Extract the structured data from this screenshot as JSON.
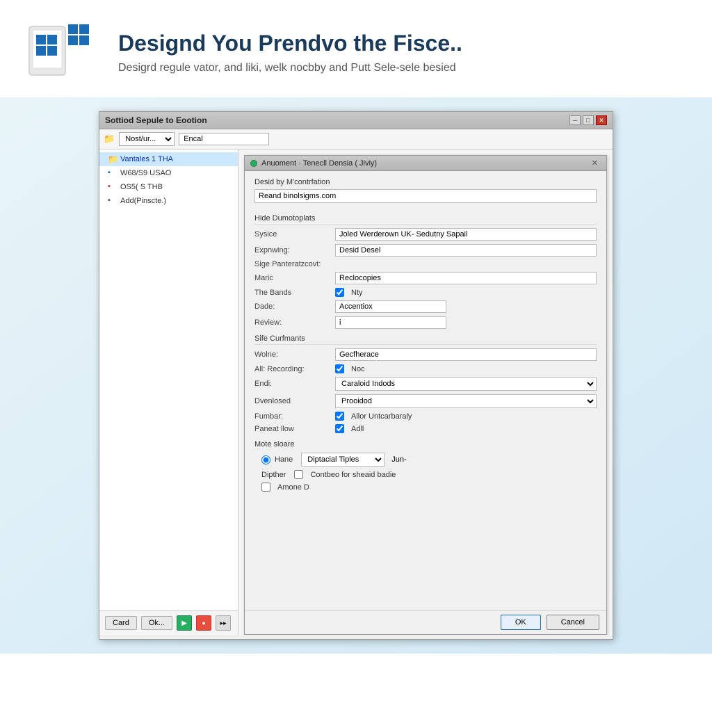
{
  "header": {
    "title": "Designd You Prendvo the Fisce..",
    "subtitle": "Desigrd regule vator, and liki, welk nocbby and Putt Sele-sele besied",
    "logo_alt": "Windows logo with tablet"
  },
  "outer_dialog": {
    "title": "Sottiod Sepule to Eootion",
    "toolbar": {
      "select_value": "Nost/ur...",
      "input_value": "Encal"
    },
    "tree_items": [
      {
        "label": "Vantales 1 THA",
        "type": "folder",
        "selected": true
      },
      {
        "label": "W68/S9 USAO",
        "type": "blue"
      },
      {
        "label": "OS5( S THB",
        "type": "red"
      },
      {
        "label": "Add(Pinscte.)",
        "type": "add"
      }
    ],
    "footer": {
      "card_btn": "Card",
      "ok_btn": "Ok..."
    }
  },
  "inner_dialog": {
    "title": "Anuoment · Tenecll Densia ( Jiviy)",
    "sections": {
      "desid_label": "Desid by M'contrfation",
      "desid_input": "Reand binolsigms.com",
      "hide_label": "Hide Dumotoplats",
      "sysice_label": "Sysice",
      "sysice_value": "Joled Werderown UK- Sedutny Sapail",
      "expnwing_label": "Expnwing:",
      "expnwing_value": "Desid Desel",
      "sige_label": "Sige Panteratzcovt:",
      "maric_label": "Maric",
      "maric_value": "Reclocopies",
      "the_bands_label": "The Bands",
      "the_bands_checked": true,
      "the_bands_text": "Nty",
      "dade_label": "Dade:",
      "dade_value": "Accentiox",
      "review_label": "Review:",
      "review_value": "i",
      "site_label": "Sife Curfmants",
      "wolne_label": "Wolne:",
      "wolne_value": "Gecfherace",
      "all_recording_label": "All: Recording:",
      "all_recording_checked": true,
      "all_recording_text": "Noc",
      "endi_label": "Endi:",
      "endi_value": "Caraloid Indods",
      "dvenlosed_label": "Dvenlosed",
      "dvenlosed_value": "Prooidod",
      "fumbar_label": "Fumbar:",
      "fumbar_checked": true,
      "fumbar_text": "Allor Untcarbaraly",
      "paneat_label": "Paneat llow",
      "paneat_checked": true,
      "paneat_text": "Adll",
      "mote_label": "Mote sloare",
      "radio_label": "Hane",
      "dropdown_value": "Diptacial Tiples",
      "more1_label": "Jun-",
      "dipther_label": "Dipther",
      "contbeo_checked": false,
      "contbeo_text": "Contbeo for sheaid badie",
      "amone_checked": false,
      "amone_text": "Amone D"
    },
    "footer": {
      "ok_label": "OK",
      "cancel_label": "Cancel"
    }
  }
}
